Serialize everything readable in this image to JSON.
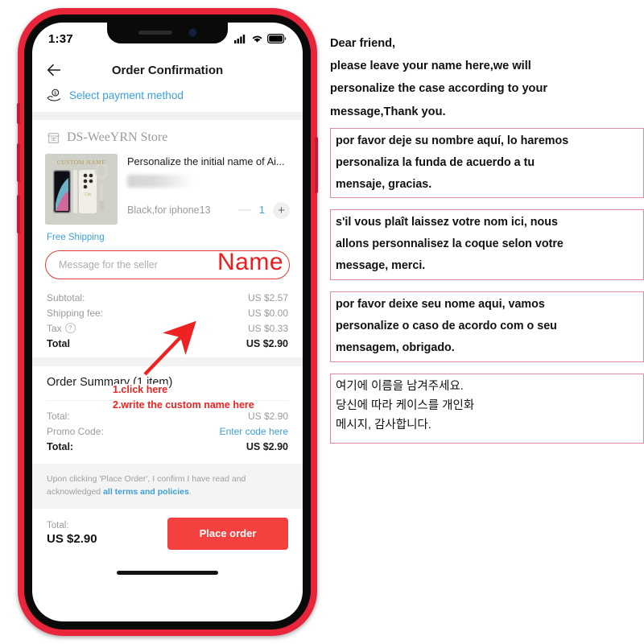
{
  "phone": {
    "status_bar": {
      "time": "1:37",
      "signal_icon": "signal-bars-icon",
      "wifi_icon": "wifi-icon",
      "battery_icon": "battery-icon"
    },
    "nav": {
      "back_icon": "back-arrow-icon",
      "title": "Order Confirmation"
    },
    "payment": {
      "icon": "hand-money-icon",
      "label": "Select payment method"
    },
    "store": {
      "icon": "storefront-icon",
      "name": "DS-WeeYRN Store"
    },
    "product": {
      "thumb_caption": "CUSTOM NAME",
      "title": "Personalize the initial name of Ai...",
      "variant": "Black,for iphone13",
      "minus_label": "—",
      "quantity": "1",
      "plus_label": "+",
      "shipping": "Free Shipping"
    },
    "message_input": {
      "placeholder": "Message for the seller",
      "value": ""
    },
    "annotations": {
      "name": "Name",
      "step1": "1.click here",
      "step2": "2.write the custom name here"
    },
    "price_rows": [
      {
        "label": "Subtotal:",
        "value": "US $2.57"
      },
      {
        "label": "Shipping fee:",
        "value": "US $0.00"
      },
      {
        "label": "Tax",
        "value": "US $0.33",
        "has_help": true
      },
      {
        "label": "Total",
        "value": "US $2.90",
        "bold": true
      }
    ],
    "order_summary": {
      "title": "Order Summary (1 item)",
      "rows": [
        {
          "label": "Total:",
          "value": "US $2.90",
          "bold": false,
          "link": false
        },
        {
          "label": "Promo Code:",
          "value": "Enter code here",
          "bold": false,
          "link": true
        },
        {
          "label": "Total:",
          "value": "US $2.90",
          "bold": true,
          "link": false
        }
      ]
    },
    "terms": {
      "text_before": "Upon clicking 'Place Order', I confirm I have read and acknowledged ",
      "link": "all terms and policies",
      "text_after": "."
    },
    "bottom_bar": {
      "total_label": "Total:",
      "total_value": "US $2.90",
      "place_order": "Place order"
    }
  },
  "instructions": {
    "english": [
      "Dear friend,",
      "please leave your name here,we will",
      "personalize the case according to your",
      "message,Thank you."
    ],
    "spanish": [
      "por favor deje su nombre aquí, lo haremos",
      "personaliza la funda de acuerdo a tu",
      "mensaje, gracias."
    ],
    "french": [
      "s'il vous plaît laissez votre nom ici, nous",
      "allons personnalisez la coque selon votre",
      "message, merci."
    ],
    "portuguese": [
      "por favor deixe seu nome aqui, vamos",
      "personalize o caso de acordo com o seu",
      "mensagem, obrigado."
    ],
    "korean": [
      "여기에 이름을 남겨주세요.",
      "당신에 따라 케이스를 개인화",
      "메시지, 감사합니다."
    ]
  },
  "colors": {
    "phone_shell": "#e8253a",
    "accent_blue": "#3c9fd6",
    "annotation_red": "#ee2222",
    "place_order_red": "#f4403f",
    "box_border_pink": "#e0899f"
  }
}
